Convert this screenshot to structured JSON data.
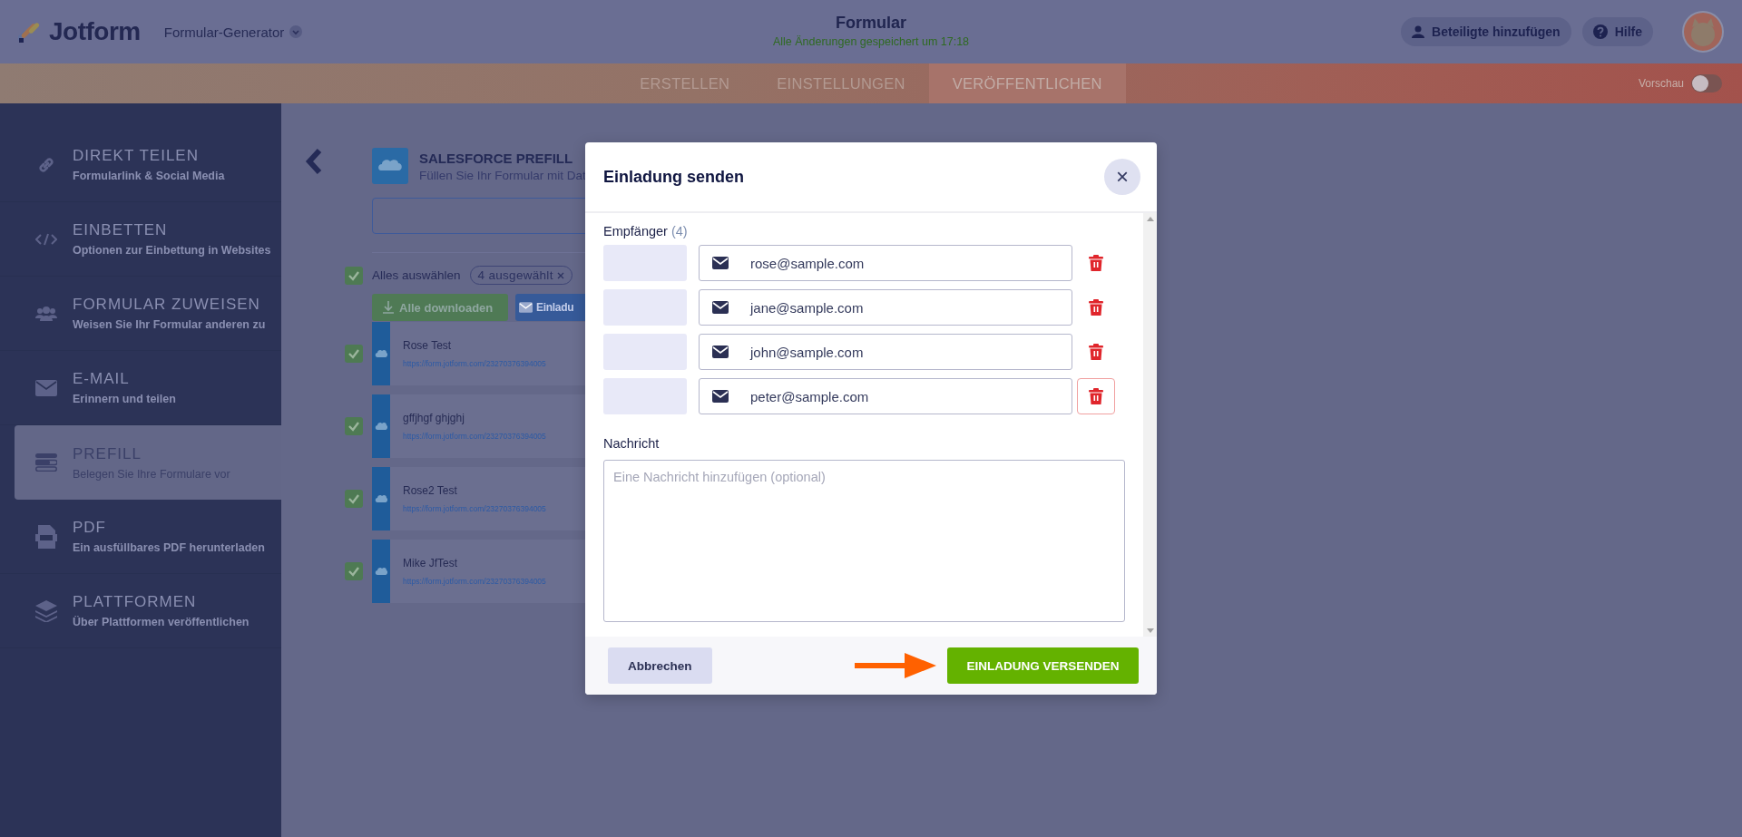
{
  "header": {
    "logo": "Jotform",
    "builder_menu": "Formular-Generator",
    "title": "Formular",
    "save_status": "Alle Änderungen gespeichert um 17:18",
    "buttons": [
      "Beteiligte hinzufügen",
      "Hilfe"
    ]
  },
  "tabs": [
    {
      "label": "ERSTELLEN",
      "selected": false
    },
    {
      "label": "EINSTELLUNGEN",
      "selected": false
    },
    {
      "label": "VERÖFFENTLICHEN",
      "selected": true
    }
  ],
  "preview": {
    "label": "Vorschau",
    "on": false
  },
  "sidebar": {
    "items": [
      {
        "title": "DIREKT TEILEN",
        "subtitle": "Formularlink & Social Media",
        "selected": false
      },
      {
        "title": "EINBETTEN",
        "subtitle": "Optionen zur Einbettung in Websites",
        "selected": false
      },
      {
        "title": "FORMULAR ZUWEISEN",
        "subtitle": "Weisen Sie Ihr Formular anderen zu",
        "selected": false
      },
      {
        "title": "E-MAIL",
        "subtitle": "Erinnern und teilen",
        "selected": false
      },
      {
        "title": "PREFILL",
        "subtitle": "Belegen Sie Ihre Formulare vor",
        "selected": true
      },
      {
        "title": "PDF",
        "subtitle": "Ein ausfüllbares PDF herunterladen",
        "selected": false
      },
      {
        "title": "PLATTFORMEN",
        "subtitle": "Über Plattformen veröffentlichen",
        "selected": false
      }
    ]
  },
  "prefill": {
    "title": "SALESFORCE PREFILL",
    "subtitle": "Füllen Sie Ihr Formular mit Dat",
    "select_all": {
      "label": "Alles auswählen",
      "checked": true
    },
    "selected_count": "4 ausgewählt",
    "buttons": [
      "Alle downloaden",
      "Einladu"
    ],
    "entries": [
      {
        "name": "Rose Test",
        "url": "https://form.jotform.com/23270376394005",
        "checked": true
      },
      {
        "name": "gffjhgf ghjghj",
        "url": "https://form.jotform.com/23270376394005",
        "checked": true
      },
      {
        "name": "Rose2 Test",
        "url": "https://form.jotform.com/23270376394005",
        "checked": true
      },
      {
        "name": "Mike JfTest",
        "url": "https://form.jotform.com/23270376394005",
        "checked": true
      }
    ]
  },
  "modal": {
    "title": "Einladung senden",
    "close": "×",
    "recipients_label": "Empfänger",
    "recipients_count": "(4)",
    "recipients": [
      {
        "email": "rose@sample.com",
        "hovered": false
      },
      {
        "email": "jane@sample.com",
        "hovered": false
      },
      {
        "email": "john@sample.com",
        "hovered": false
      },
      {
        "email": "peter@sample.com",
        "hovered": true
      }
    ],
    "message_label": "Nachricht",
    "message_placeholder": "Eine Nachricht hinzufügen (optional)",
    "cancel": "Abbrechen",
    "submit": "EINLADUNG VERSENDEN"
  }
}
